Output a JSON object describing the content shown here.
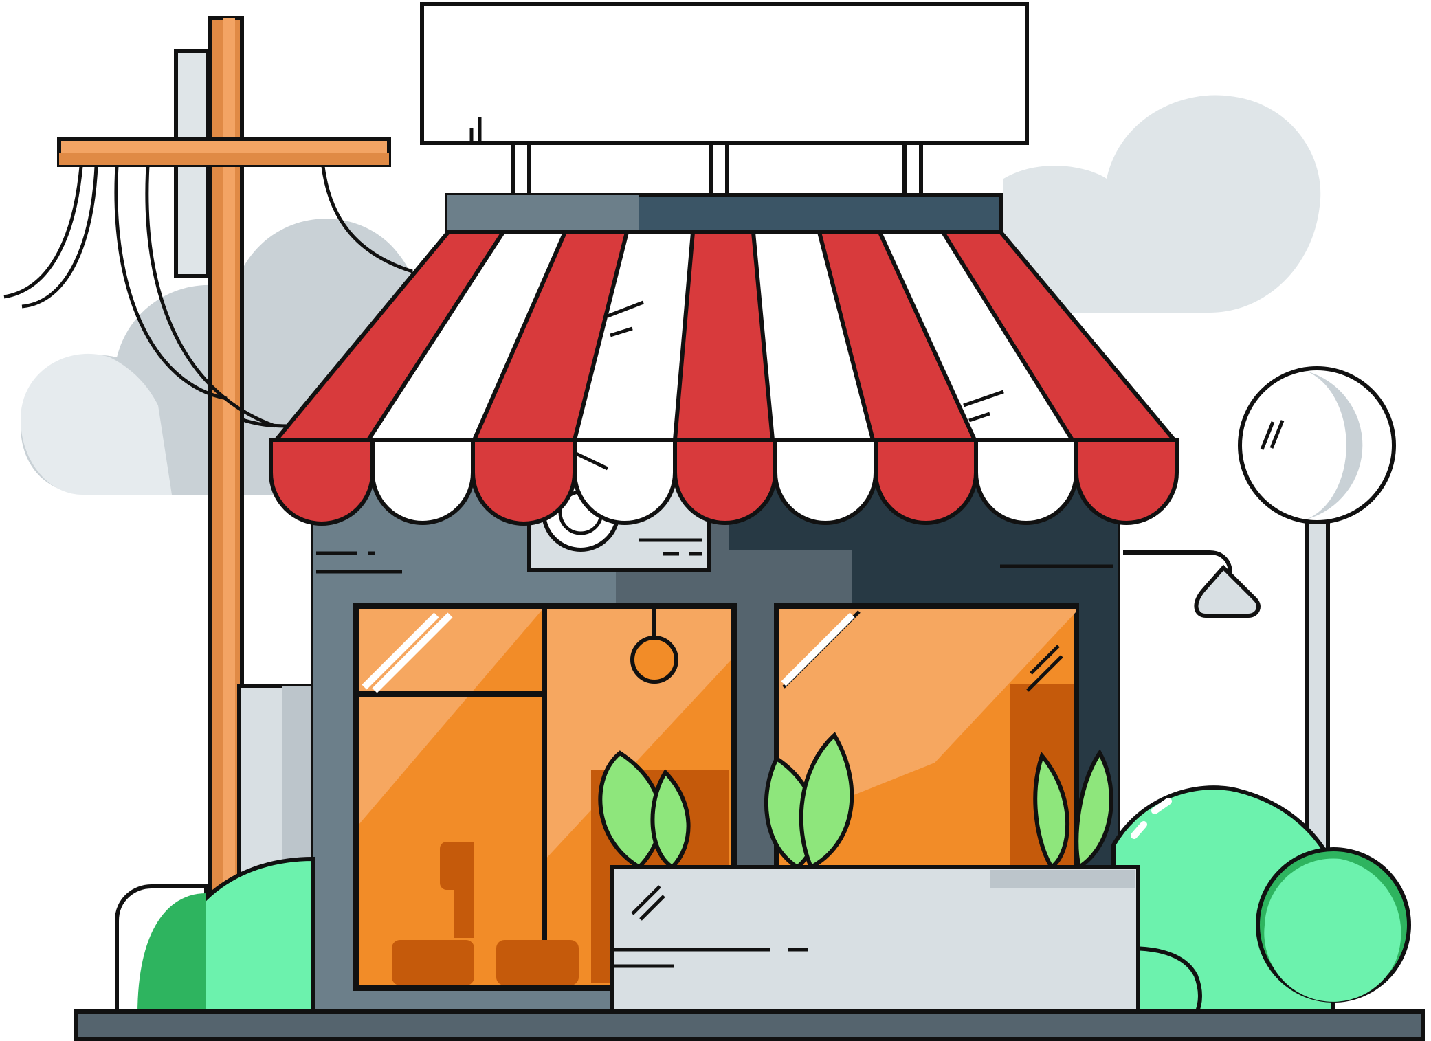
{
  "illustration": {
    "signboard_text": "",
    "colors": {
      "outline": "#111111",
      "cloud": "#c9d1d6",
      "cloud_light": "#e6ebee",
      "awning_red": "#d83a3c",
      "awning_red_dark": "#a31f2b",
      "awning_white": "#ffffff",
      "wall": "#55646e",
      "wall_light": "#6c7f8a",
      "wall_dark": "#273944",
      "roof_band": "#3b5566",
      "glass_light": "#f6a760",
      "glass": "#f28c28",
      "glass_dark": "#c55a0b",
      "pole_wood": "#e08a45",
      "pole_wood_light": "#f3a464",
      "bush": "#6cf2ad",
      "bush_dark": "#2eb45f",
      "leaf": "#8ee67c",
      "leaf_dark": "#2ea343",
      "planter": "#d8dfe3",
      "planter_shadow": "#bcc5cb",
      "ground": "#55646e"
    }
  }
}
